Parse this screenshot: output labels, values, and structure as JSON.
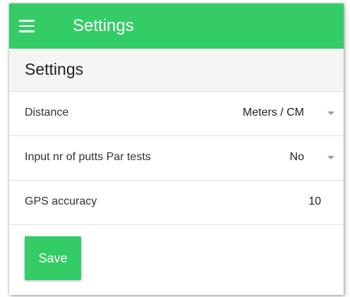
{
  "appbar": {
    "title": "Settings",
    "menu_icon": "hamburger-menu-icon",
    "color": "#33cc66"
  },
  "section": {
    "title": "Settings"
  },
  "settings": [
    {
      "label": "Distance",
      "value": "Meters / CM",
      "type": "select"
    },
    {
      "label": "Input nr of putts Par tests",
      "value": "No",
      "type": "select"
    },
    {
      "label": "GPS accuracy",
      "value": "10",
      "type": "number"
    }
  ],
  "actions": {
    "save_label": "Save"
  }
}
